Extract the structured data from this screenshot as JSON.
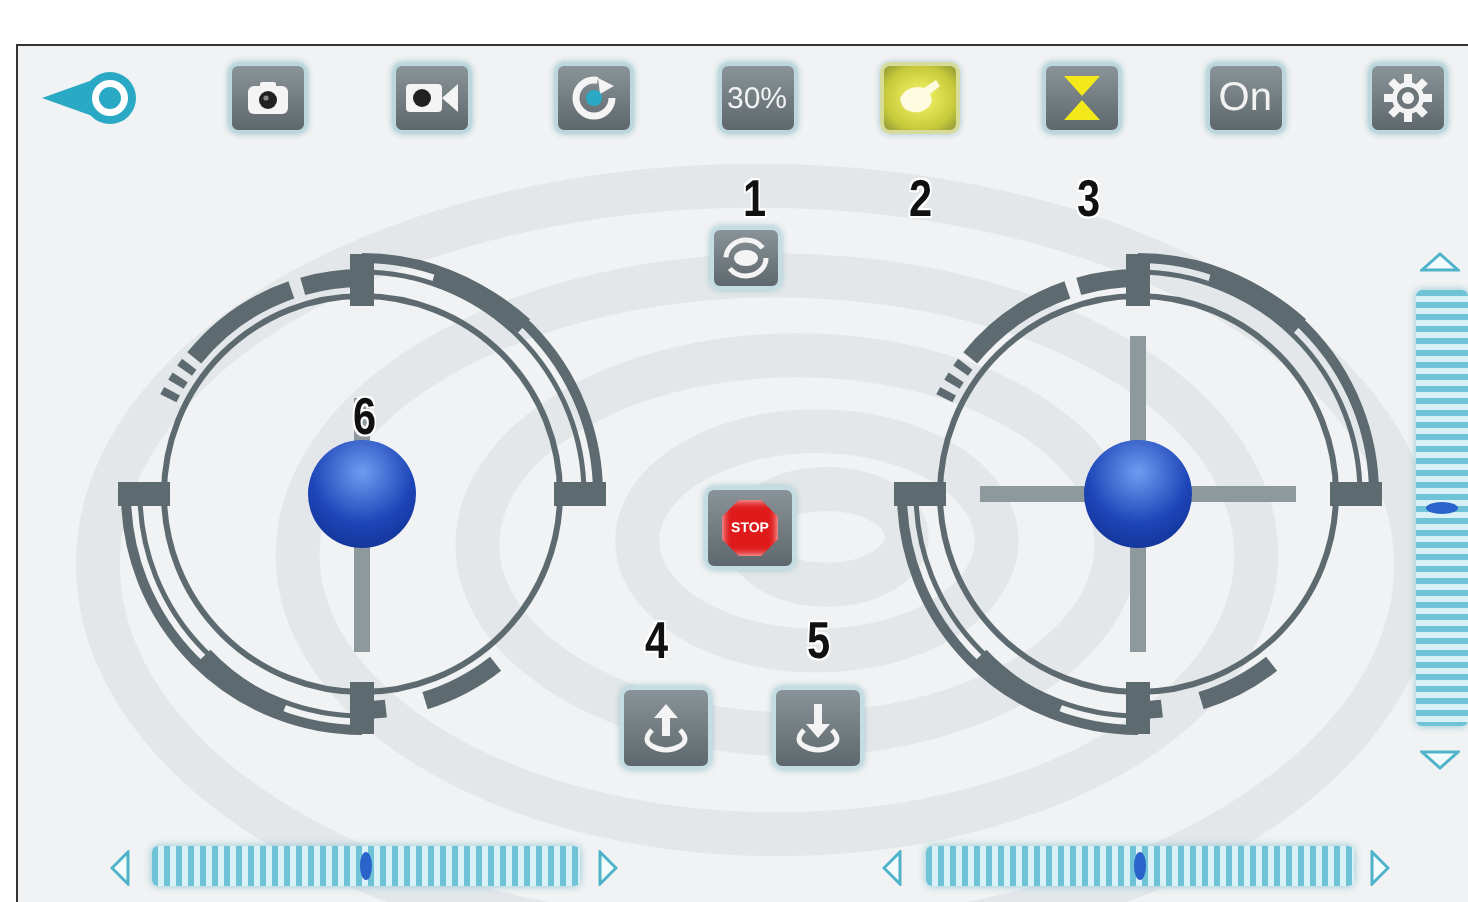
{
  "toolbar": [
    {
      "kind": "back"
    },
    {
      "kind": "photo"
    },
    {
      "kind": "video"
    },
    {
      "kind": "rotate"
    },
    {
      "kind": "speed",
      "label": "30%",
      "marker": "1"
    },
    {
      "kind": "light",
      "on": true,
      "marker": "2"
    },
    {
      "kind": "flip",
      "marker": "3"
    },
    {
      "kind": "toggle",
      "label": "On"
    },
    {
      "kind": "settings"
    }
  ],
  "flip_360_button": {
    "kind": "flip360"
  },
  "stop_button": {
    "label": "STOP"
  },
  "takeoff_button": {
    "marker": "4"
  },
  "landing_button": {
    "marker": "5"
  },
  "joysticks": [
    {
      "kind": "throttle",
      "marker": "6"
    },
    {
      "kind": "direction"
    }
  ],
  "trims": [
    {
      "kind": "horizontal",
      "level": 0.5
    },
    {
      "kind": "horizontal",
      "level": 0.5
    },
    {
      "kind": "vertical",
      "level": 0.5
    }
  ]
}
